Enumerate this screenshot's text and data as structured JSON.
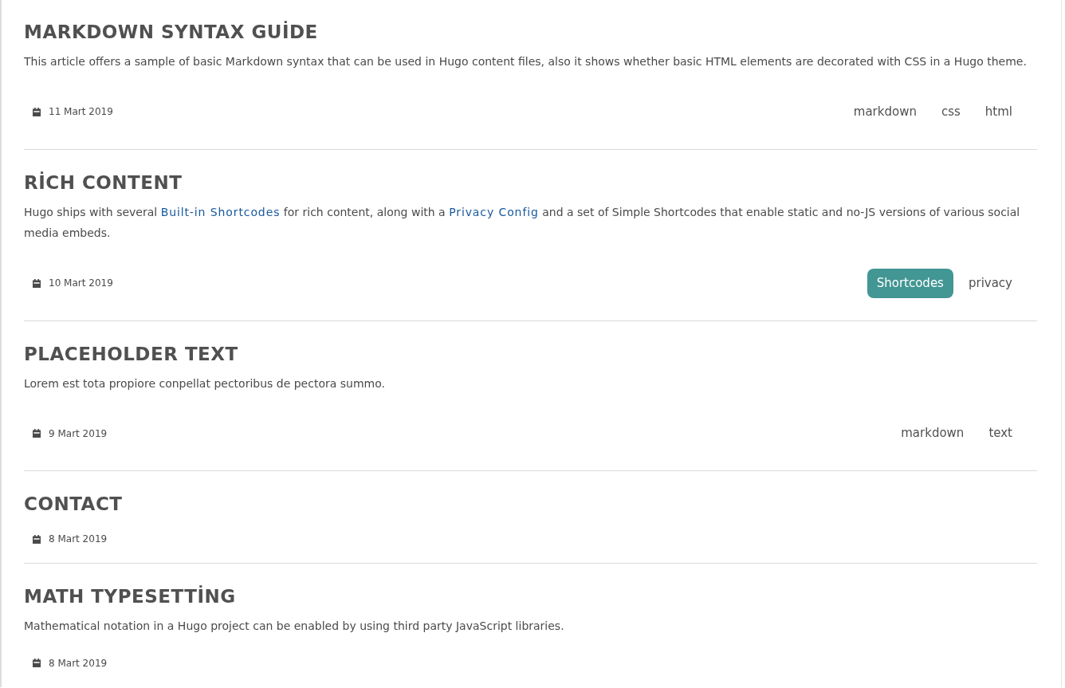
{
  "articles": [
    {
      "title": "MARKDOWN SYNTAX GUİDE",
      "summary": [
        {
          "kind": "text",
          "text": "This article offers a sample of basic Markdown syntax that can be used in Hugo content files, also it shows whether basic HTML elements are decorated with CSS in a Hugo theme."
        }
      ],
      "date": "11 Mart 2019",
      "tags": [
        {
          "label": "markdown",
          "selected": false
        },
        {
          "label": "css",
          "selected": false
        },
        {
          "label": "html",
          "selected": false
        }
      ]
    },
    {
      "title": "RİCH CONTENT",
      "summary": [
        {
          "kind": "text",
          "text": "Hugo ships with several "
        },
        {
          "kind": "link",
          "text": "Built-in Shortcodes"
        },
        {
          "kind": "text",
          "text": " for rich content, along with a "
        },
        {
          "kind": "link",
          "text": "Privacy Config"
        },
        {
          "kind": "text",
          "text": " and a set of Simple Shortcodes that enable static and no-JS versions of various social media embeds."
        }
      ],
      "date": "10 Mart 2019",
      "tags": [
        {
          "label": "Shortcodes",
          "selected": true
        },
        {
          "label": "privacy",
          "selected": false
        }
      ]
    },
    {
      "title": "PLACEHOLDER TEXT",
      "summary": [
        {
          "kind": "text",
          "text": "Lorem est tota propiore conpellat pectoribus de pectora summo."
        }
      ],
      "date": "9 Mart 2019",
      "tags": [
        {
          "label": "markdown",
          "selected": false
        },
        {
          "label": "text",
          "selected": false
        }
      ]
    },
    {
      "title": "CONTACT",
      "date": "8 Mart 2019"
    },
    {
      "title": "MATH TYPESETTİNG",
      "summary": [
        {
          "kind": "text",
          "text": "Mathematical notation in a Hugo project can be enabled by using third party JavaScript libraries."
        }
      ],
      "date": "8 Mart 2019"
    }
  ]
}
